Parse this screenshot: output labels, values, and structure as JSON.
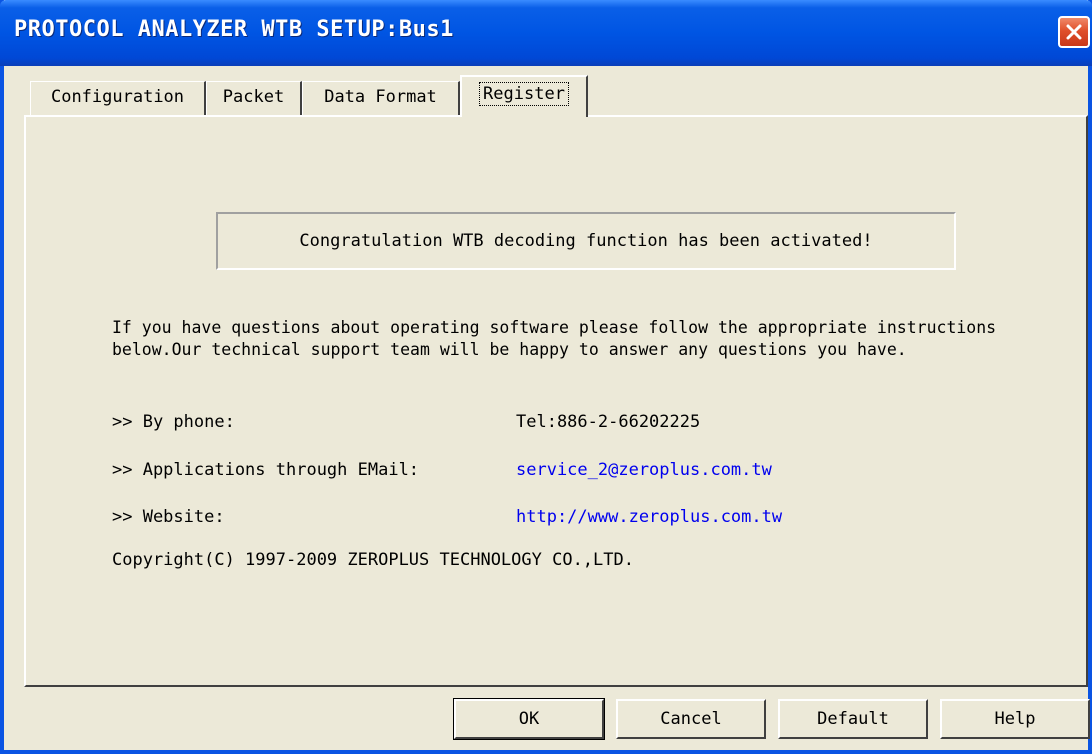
{
  "window": {
    "title": "PROTOCOL ANALYZER WTB SETUP:Bus1"
  },
  "tabs": [
    {
      "label": "Configuration",
      "active": false
    },
    {
      "label": "Packet",
      "active": false
    },
    {
      "label": "Data Format",
      "active": false
    },
    {
      "label": "Register",
      "active": true
    }
  ],
  "register": {
    "activation_message": "Congratulation WTB decoding function has been activated!",
    "support_text": "If you have questions about operating software please follow the appropriate instructions below.Our technical support team will be happy to answer any questions you have.",
    "contacts": [
      {
        "label": ">> By phone:",
        "value": "Tel:886-2-66202225"
      },
      {
        "label": ">> Applications through EMail:",
        "value": "service_2@zeroplus.com.tw"
      },
      {
        "label": ">> Website:",
        "value": "http://www.zeroplus.com.tw"
      }
    ],
    "copyright": "Copyright(C) 1997-2009 ZEROPLUS TECHNOLOGY CO.,LTD."
  },
  "buttons": {
    "ok": "OK",
    "cancel": "Cancel",
    "default": "Default",
    "help": "Help"
  },
  "colors": {
    "titlebar": "#0055e3",
    "link": "#0000ee",
    "face": "#ece9d8",
    "close": "#e0502a"
  },
  "icons": {
    "close": "close-icon"
  }
}
